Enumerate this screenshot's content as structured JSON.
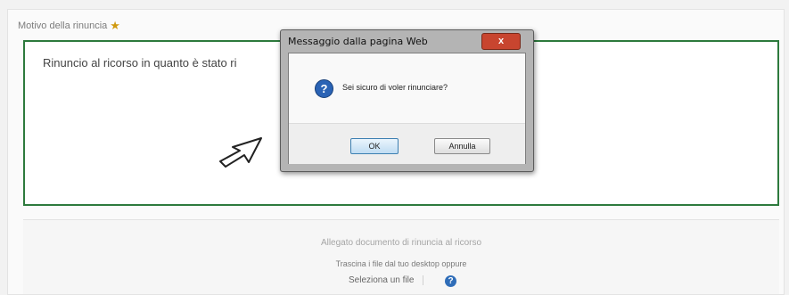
{
  "form": {
    "label": "Motivo della rinuncia",
    "required_icon": "star-icon",
    "textarea_value": "Rinuncio al ricorso in quanto è stato ri",
    "attach_title": "Allegato documento di rinuncia al ricorso",
    "drag_hint": "Trascina i file dal tuo desktop oppure",
    "select_file_label": "Seleziona un file",
    "help_icon_label": "?"
  },
  "dialog": {
    "title": "Messaggio dalla pagina Web",
    "close_label": "x",
    "message": "Sei sicuro di voler rinunciare?",
    "icon": "question-icon",
    "ok_label": "OK",
    "cancel_label": "Annulla"
  },
  "colors": {
    "textarea_border": "#2d7a3d",
    "close_button": "#c8452f",
    "question_icon": "#2a63b5"
  }
}
